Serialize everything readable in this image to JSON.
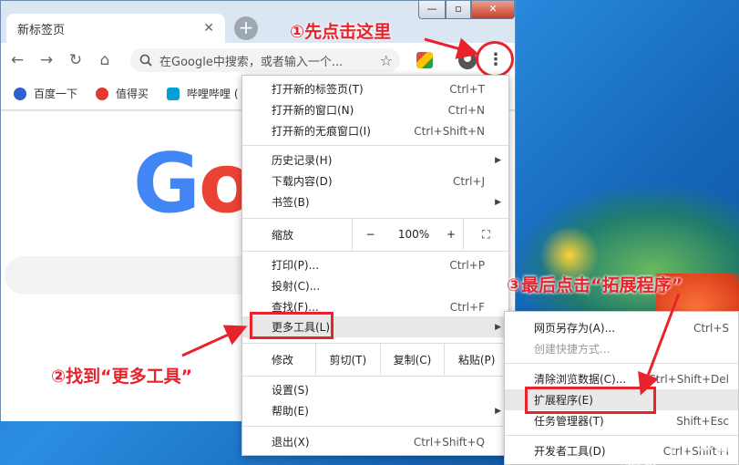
{
  "browser": {
    "tab_title": "新标签页",
    "tab_close": "✕",
    "new_tab": "+",
    "window_controls": {
      "minimize": "—",
      "maximize": "▫",
      "close": "✕"
    },
    "nav": {
      "back": "←",
      "forward": "→",
      "reload": "↻",
      "home": "⌂"
    },
    "omnibox_placeholder": "在Google中搜索，或者输入一个...",
    "menu_button": "⋮",
    "bookmarks": [
      {
        "label": "百度一下",
        "icon": "baidu-icon"
      },
      {
        "label": "值得买",
        "icon": "smzdm-icon"
      },
      {
        "label": "哔哩哔哩 (",
        "icon": "bilibili-icon"
      }
    ],
    "google_logo": [
      "G",
      "o"
    ]
  },
  "menu": {
    "new_tab": {
      "label": "打开新的标签页(T)",
      "shortcut": "Ctrl+T"
    },
    "new_window": {
      "label": "打开新的窗口(N)",
      "shortcut": "Ctrl+N"
    },
    "incognito": {
      "label": "打开新的无痕窗口(I)",
      "shortcut": "Ctrl+Shift+N"
    },
    "history": {
      "label": "历史记录(H)"
    },
    "downloads": {
      "label": "下载内容(D)",
      "shortcut": "Ctrl+J"
    },
    "bookmarks": {
      "label": "书签(B)"
    },
    "zoom": {
      "label": "缩放",
      "minus": "−",
      "value": "100%",
      "plus": "+",
      "fullscreen": "⛶"
    },
    "print": {
      "label": "打印(P)...",
      "shortcut": "Ctrl+P"
    },
    "cast": {
      "label": "投射(C)..."
    },
    "find": {
      "label": "查找(F)...",
      "shortcut": "Ctrl+F"
    },
    "more_tools": {
      "label": "更多工具(L)"
    },
    "edit": {
      "label": "修改",
      "cut": "剪切(T)",
      "copy": "复制(C)",
      "paste": "粘贴(P)"
    },
    "settings": {
      "label": "设置(S)"
    },
    "help": {
      "label": "帮助(E)"
    },
    "exit": {
      "label": "退出(X)",
      "shortcut": "Ctrl+Shift+Q"
    }
  },
  "submenu": {
    "save_page": {
      "label": "网页另存为(A)...",
      "shortcut": "Ctrl+S"
    },
    "create_shortcut": {
      "label": "创建快捷方式..."
    },
    "clear_data": {
      "label": "清除浏览数据(C)...",
      "shortcut": "Ctrl+Shift+Del"
    },
    "extensions": {
      "label": "扩展程序(E)"
    },
    "task_manager": {
      "label": "任务管理器(T)",
      "shortcut": "Shift+Esc"
    },
    "dev_tools": {
      "label": "开发者工具(D)",
      "shortcut": "Ctrl+Shift+I"
    }
  },
  "annotations": {
    "step1": "①先点击这里",
    "step2": "②找到“更多工具”",
    "step3": "③最后点击“拓展程序”"
  },
  "watermark": "值 | 什么值得买",
  "colors": {
    "highlight": "#e8232b",
    "google_blue": "#4285f4",
    "google_red": "#ea4335"
  }
}
